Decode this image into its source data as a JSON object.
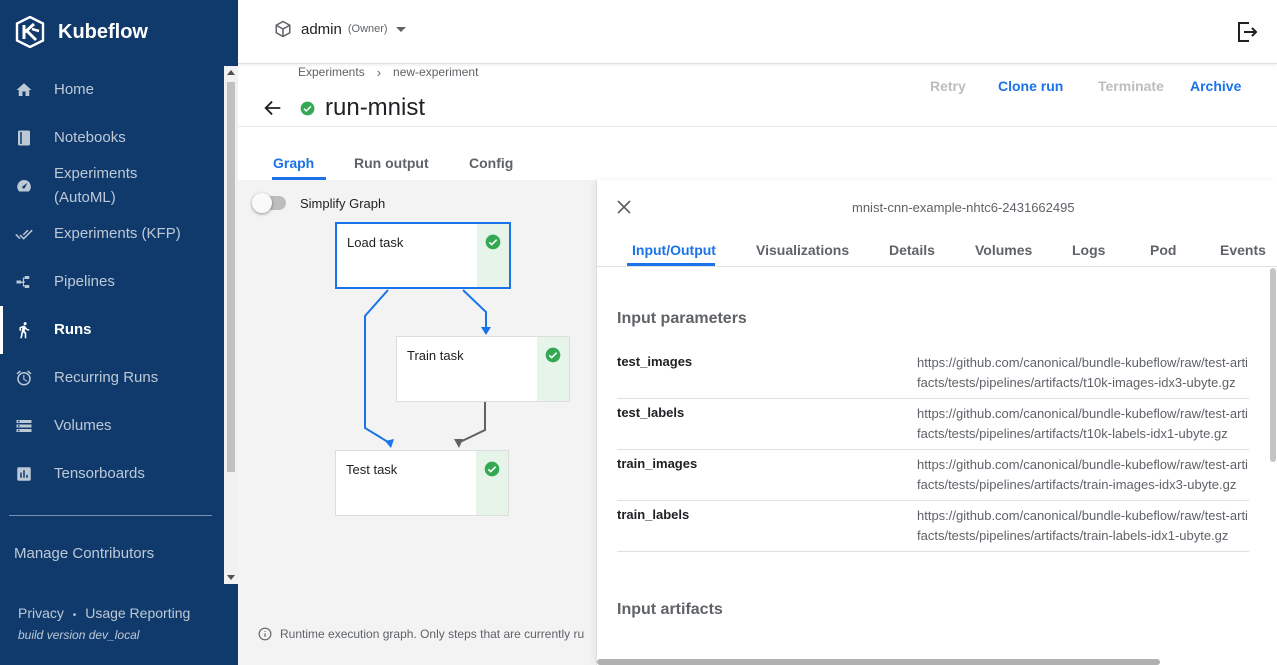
{
  "app": {
    "name": "Kubeflow"
  },
  "sidebar": {
    "items": [
      {
        "label": "Home",
        "icon": "home-icon"
      },
      {
        "label": "Notebooks",
        "icon": "notebook-icon"
      },
      {
        "label": "Experiments (AutoML)",
        "icon": "speedometer-icon"
      },
      {
        "label": "Experiments (KFP)",
        "icon": "check-all-icon"
      },
      {
        "label": "Pipelines",
        "icon": "pipeline-icon"
      },
      {
        "label": "Runs",
        "icon": "run-icon",
        "active": true
      },
      {
        "label": "Recurring Runs",
        "icon": "alarm-icon"
      },
      {
        "label": "Volumes",
        "icon": "storage-icon"
      },
      {
        "label": "Tensorboards",
        "icon": "chart-icon"
      }
    ],
    "manage_contributors": "Manage Contributors",
    "privacy": "Privacy",
    "bullet": "•",
    "usage_reporting": "Usage Reporting",
    "build_version": "build version dev_local"
  },
  "topbar": {
    "namespace": "admin",
    "role": "(Owner)"
  },
  "breadcrumb": {
    "items": [
      "Experiments",
      "new-experiment"
    ],
    "separator": "›"
  },
  "run": {
    "title": "run-mnist",
    "status": "succeeded"
  },
  "actions": {
    "retry": "Retry",
    "clone_run": "Clone run",
    "terminate": "Terminate",
    "archive": "Archive"
  },
  "tabs": [
    "Graph",
    "Run output",
    "Config"
  ],
  "graph": {
    "simplify_label": "Simplify Graph",
    "simplify_on": false,
    "nodes": [
      {
        "label": "Load task",
        "status": "succeeded",
        "selected": true
      },
      {
        "label": "Train task",
        "status": "succeeded"
      },
      {
        "label": "Test task",
        "status": "succeeded"
      }
    ],
    "note": "Runtime execution graph. Only steps that are currently ru"
  },
  "panel": {
    "pod_name": "mnist-cnn-example-nhtc6-2431662495",
    "tabs": [
      "Input/Output",
      "Visualizations",
      "Details",
      "Volumes",
      "Logs",
      "Pod",
      "Events"
    ],
    "input_parameters_title": "Input parameters",
    "params": [
      {
        "key": "test_images",
        "value": "https://github.com/canonical/bundle-kubeflow/raw/test-artifacts/tests/pipelines/artifacts/t10k-images-idx3-ubyte.gz"
      },
      {
        "key": "test_labels",
        "value": "https://github.com/canonical/bundle-kubeflow/raw/test-artifacts/tests/pipelines/artifacts/t10k-labels-idx1-ubyte.gz"
      },
      {
        "key": "train_images",
        "value": "https://github.com/canonical/bundle-kubeflow/raw/test-artifacts/tests/pipelines/artifacts/train-images-idx3-ubyte.gz"
      },
      {
        "key": "train_labels",
        "value": "https://github.com/canonical/bundle-kubeflow/raw/test-artifacts/tests/pipelines/artifacts/train-labels-idx1-ubyte.gz"
      }
    ],
    "input_artifacts_title": "Input artifacts"
  },
  "colors": {
    "sidebar_bg": "#0f3a6b",
    "accent": "#1a73e8",
    "success": "#34a853",
    "disabled": "#bdbdbd"
  }
}
